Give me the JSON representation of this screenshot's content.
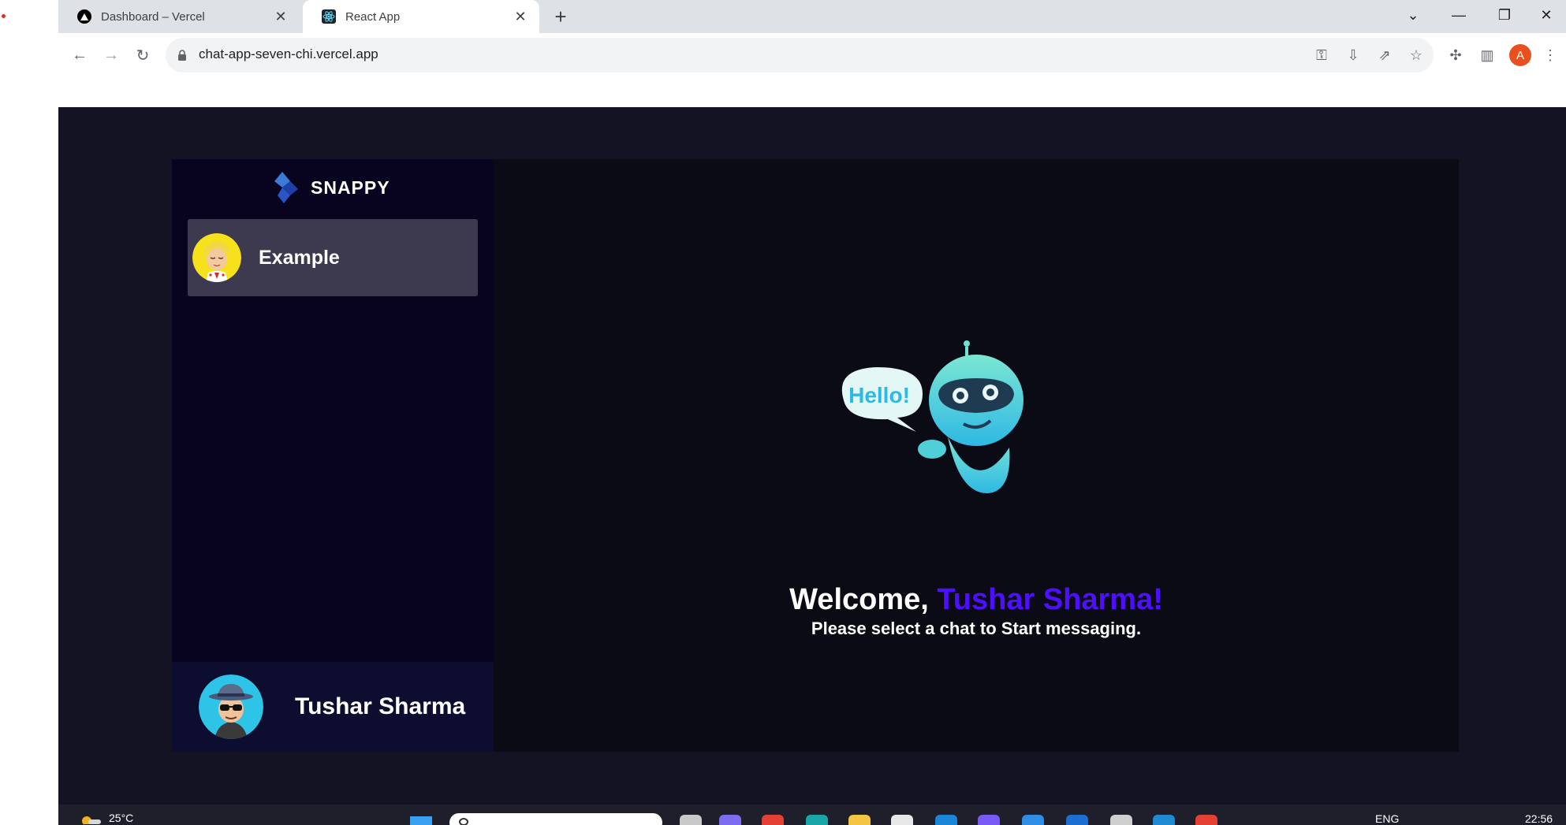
{
  "browser": {
    "tabs": [
      {
        "title": "Dashboard – Vercel",
        "active": false,
        "icon": "vercel-icon"
      },
      {
        "title": "React App",
        "active": true,
        "icon": "react-icon"
      }
    ],
    "url": "chat-app-seven-chi.vercel.app",
    "profile_initial": "A"
  },
  "app": {
    "brand": "SNAPPY",
    "contacts": [
      {
        "name": "Example",
        "avatar": "blonde-avatar"
      }
    ],
    "current_user": {
      "name": "Tushar Sharma",
      "avatar": "hat-sunglasses-avatar"
    },
    "welcome": {
      "prefix": "Welcome,",
      "username": "Tushar Sharma!",
      "subtitle": "Please select a chat to Start messaging."
    },
    "robot_bubble": "Hello!",
    "colors": {
      "accent": "#4e0eff",
      "background": "#131324",
      "sidebar": "#080420",
      "selected_contact": "#3d3a50"
    }
  },
  "taskbar": {
    "weather": "25°C",
    "language": "ENG",
    "time": "22:56"
  }
}
